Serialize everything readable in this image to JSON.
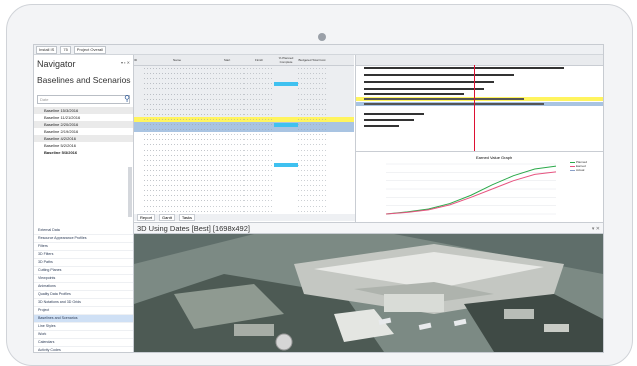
{
  "topbar": {
    "selector_1": "Install IS",
    "selector_2": "75",
    "selector_3": "Project Overall"
  },
  "navigator": {
    "title": "Navigator",
    "subtitle": "Baselines and Scenarios",
    "search_placeholder": "Date",
    "baselines": [
      "Baseline 15/3/2016",
      "Baseline 11/21/2016",
      "Baseline 2/20/2016",
      "Baseline 2/19/2016",
      "Baseline 4/2/2016",
      "Baseline 5/2/2016",
      "Baseline 5/3/2016"
    ],
    "sections": [
      "External Data",
      "Resource Appearance Profiles",
      "Filters",
      "3D Filters",
      "3D Paths",
      "Cutting Planes",
      "Viewpoints",
      "Animations",
      "Quality Data Profiles",
      "3D Notations and 3D Grids",
      "Project",
      "Baselines and Scenarios",
      "Line Styles",
      "Work",
      "Calendars",
      "Activity Codes",
      "Wbs"
    ]
  },
  "grid": {
    "columns": [
      "ID",
      "Name",
      "Start",
      "Finish",
      "% Planned Complete",
      "Budgeted Total Cost"
    ],
    "tabs": [
      "Report",
      "Gantt",
      "Tasks"
    ]
  },
  "view3d": {
    "title": "3D Using Dates [Best] [1698x492]"
  },
  "chart_data": {
    "type": "line",
    "title": "Earned Value Graph",
    "series": [
      {
        "color": "#2ba94a",
        "values": [
          0,
          5,
          12,
          25,
          45,
          70,
          92,
          108,
          115
        ]
      },
      {
        "color": "#e75480",
        "values": [
          0,
          4,
          10,
          22,
          40,
          60,
          80,
          95,
          101
        ]
      }
    ],
    "legend": [
      "Planned",
      "Earned",
      "Actual"
    ],
    "colors": {
      "series_3": "#8aa0c8"
    }
  },
  "colors": {
    "highlight_yellow": "#fff45e",
    "highlight_blue": "#a9c4e2",
    "cyan": "#3fc1f0",
    "current_date_line": "#dd1133"
  }
}
